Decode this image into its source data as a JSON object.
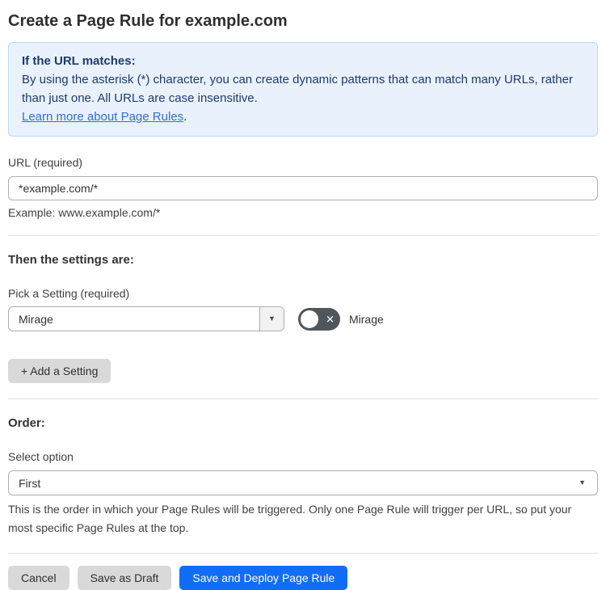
{
  "page": {
    "title": "Create a Page Rule for example.com"
  },
  "info_box": {
    "heading": "If the URL matches:",
    "body": "By using the asterisk (*) character, you can create dynamic patterns that can match many URLs, rather than just one. All URLs are case insensitive.",
    "link_label": "Learn more about Page Rules",
    "link_suffix": "."
  },
  "url_field": {
    "label": "URL (required)",
    "value": "*example.com/*",
    "example": "Example: www.example.com/*"
  },
  "settings_section": {
    "heading": "Then the settings are:",
    "picker_label": "Pick a Setting (required)",
    "picker_value": "Mirage",
    "toggle_label": "Mirage",
    "toggle_state": "off",
    "add_setting_label": "+ Add a Setting"
  },
  "order_section": {
    "heading": "Order:",
    "select_label": "Select option",
    "select_value": "First",
    "help_text": "This is the order in which your Page Rules will be triggered. Only one Page Rule will trigger per URL, so put your most specific Page Rules at the top."
  },
  "footer": {
    "cancel_label": "Cancel",
    "save_draft_label": "Save as Draft",
    "save_deploy_label": "Save and Deploy Page Rule"
  },
  "icons": {
    "dropdown_arrow": "▼",
    "toggle_off_x": "✕"
  },
  "colors": {
    "accent_blue": "#116df6",
    "info_bg": "#e9f2fc",
    "info_border": "#bcd7f2",
    "info_text": "#1e3a6d",
    "link_blue": "#2f6fd6",
    "toggle_off_bg": "#51565c",
    "button_gray": "#d9d9d9"
  }
}
